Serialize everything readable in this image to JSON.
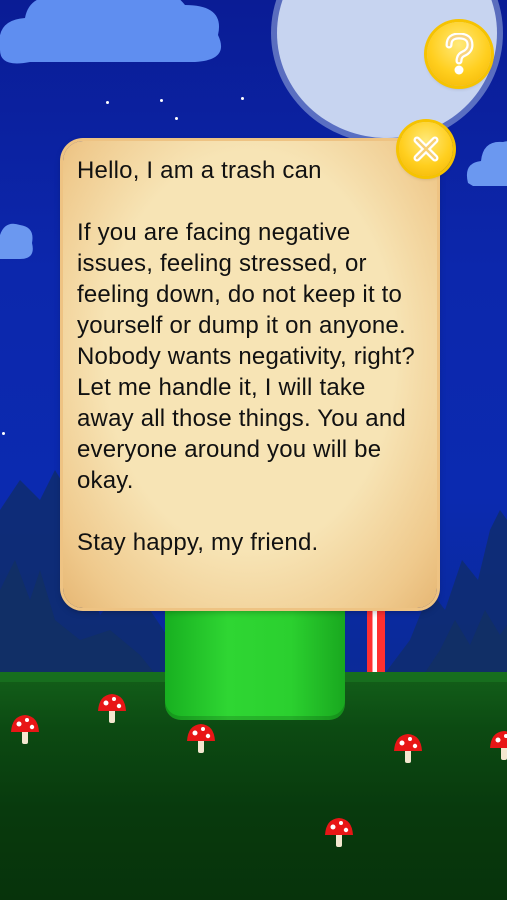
{
  "popup": {
    "greeting": "Hello, I am a trash can",
    "body": [
      "If you are facing negative issues, feeling stressed, or feeling down, do not keep it to yourself or dump it on anyone.",
      "Nobody wants negativity, right? Let me handle it, I will take away all those things. You and everyone around you will be okay."
    ],
    "closing": "Stay happy, my friend."
  },
  "buttons": {
    "help_icon": "question-mark-icon",
    "close_icon": "close-x-icon"
  },
  "colors": {
    "sky": "#0b2ab0",
    "note_paper": "#f7e4b5",
    "button_gold": "#ffcf1f",
    "bin_green": "#2fd633",
    "grass": "#0c4a12"
  }
}
